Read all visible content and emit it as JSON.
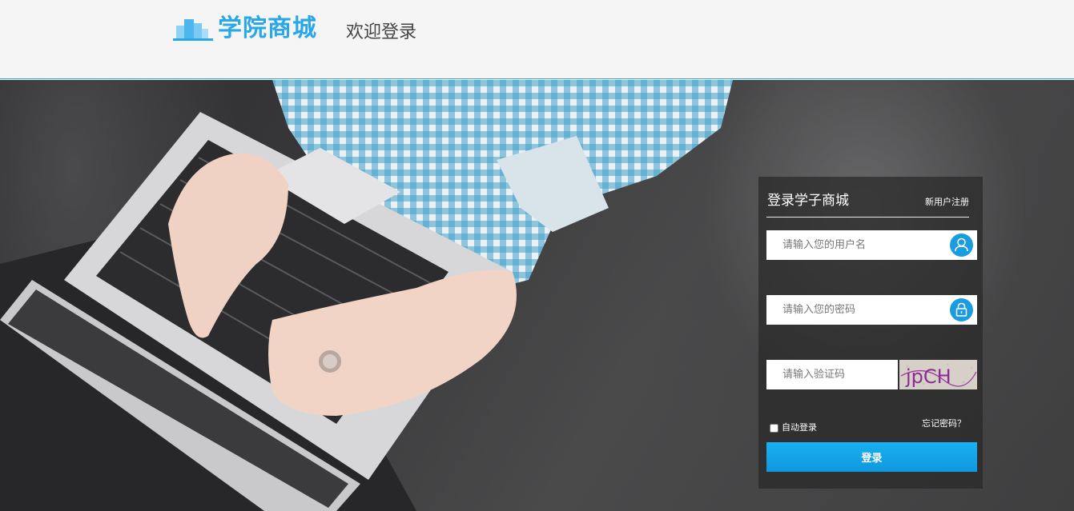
{
  "header": {
    "logo_text": "学院商城",
    "welcome": "欢迎登录"
  },
  "login": {
    "title": "登录学子商城",
    "register": "新用户注册",
    "username_placeholder": "请输入您的用户名",
    "password_placeholder": "请输入您的密码",
    "captcha_placeholder": "请输入验证码",
    "captcha_text": "jpCH",
    "auto_login": "自动登录",
    "forgot": "忘记密码？",
    "submit": "登录"
  },
  "colors": {
    "accent": "#1a9de0",
    "logo": "#2aa7e6"
  },
  "icons": {
    "user": "user-icon",
    "lock": "lock-icon"
  }
}
